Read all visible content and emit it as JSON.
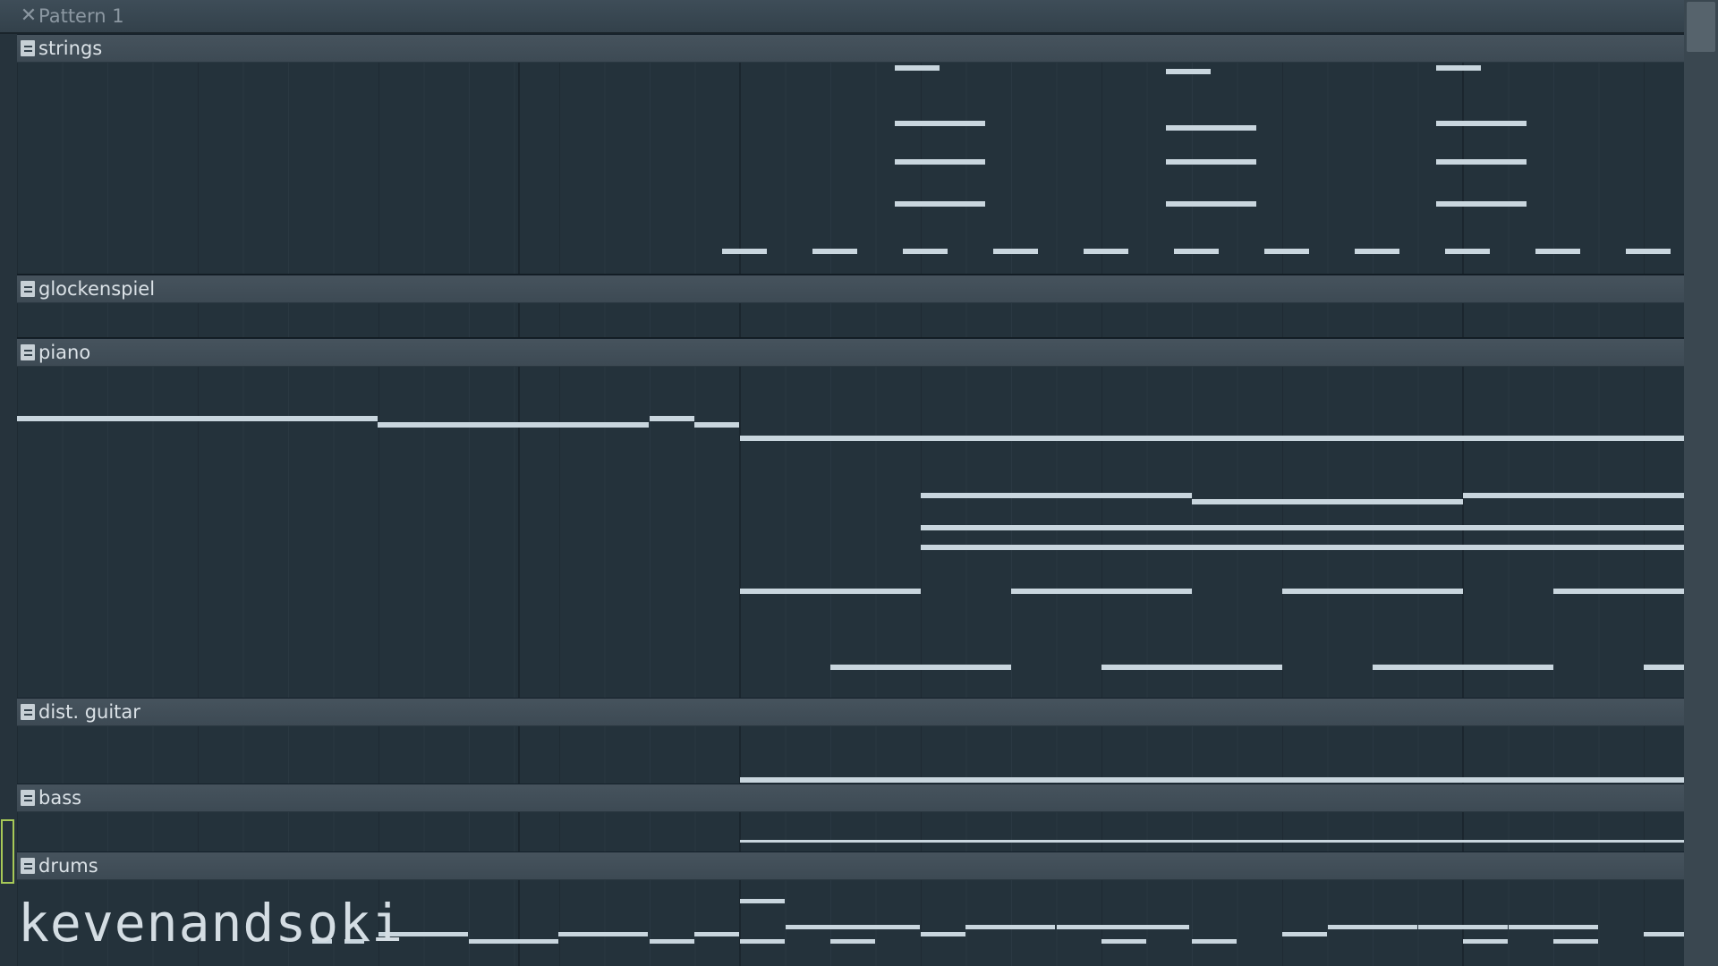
{
  "window": {
    "title": "Pattern 1",
    "close_icon": "close-x-icon"
  },
  "colors": {
    "background": "#24323b",
    "header": "#3d4a54",
    "note": "#c9d6de",
    "selection_marker": "#a7c957"
  },
  "tracks": [
    {
      "name": "strings"
    },
    {
      "name": "glockenspiel"
    },
    {
      "name": "piano"
    },
    {
      "name": "dist. guitar"
    },
    {
      "name": "bass"
    },
    {
      "name": "drums"
    }
  ],
  "watermark": "kevenandsoki"
}
